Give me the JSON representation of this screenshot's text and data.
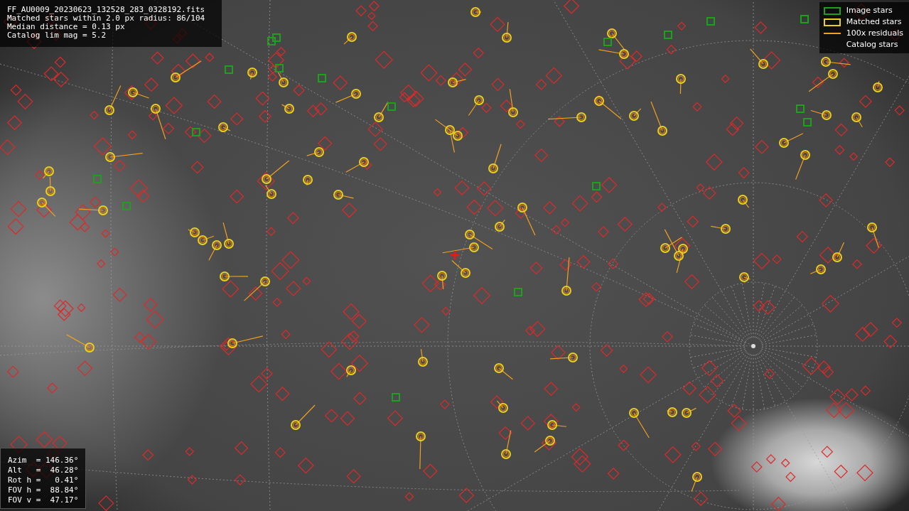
{
  "info_box": {
    "lines": [
      "FF_AU0009_20230623_132528_283_0328192.fits",
      "Matched stars within 2.0 px radius: 86/104",
      "Median distance = 0.13 px",
      "Catalog lim mag = 5.2"
    ]
  },
  "legend": [
    {
      "kind": "image",
      "label": "Image stars"
    },
    {
      "kind": "matched",
      "label": "Matched stars"
    },
    {
      "kind": "residual",
      "label": "100x residuals"
    },
    {
      "kind": "catalog",
      "label": "Catalog stars"
    }
  ],
  "pointing_box": {
    "lines": [
      "Azim  = 146.36°",
      "Alt   =  46.28°",
      "Rot h =   0.41°",
      "FOV h =  88.84°",
      "FOV v =  47.17°"
    ]
  }
}
